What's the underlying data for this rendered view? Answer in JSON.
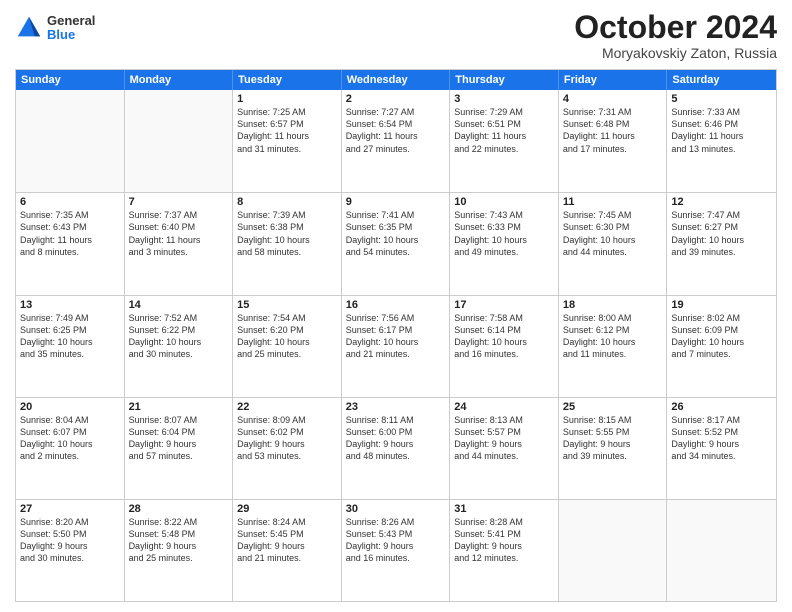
{
  "header": {
    "logo_general": "General",
    "logo_blue": "Blue",
    "month_title": "October 2024",
    "location": "Moryakovskiy Zaton, Russia"
  },
  "calendar": {
    "days": [
      "Sunday",
      "Monday",
      "Tuesday",
      "Wednesday",
      "Thursday",
      "Friday",
      "Saturday"
    ],
    "rows": [
      [
        {
          "num": "",
          "lines": []
        },
        {
          "num": "",
          "lines": []
        },
        {
          "num": "1",
          "lines": [
            "Sunrise: 7:25 AM",
            "Sunset: 6:57 PM",
            "Daylight: 11 hours",
            "and 31 minutes."
          ]
        },
        {
          "num": "2",
          "lines": [
            "Sunrise: 7:27 AM",
            "Sunset: 6:54 PM",
            "Daylight: 11 hours",
            "and 27 minutes."
          ]
        },
        {
          "num": "3",
          "lines": [
            "Sunrise: 7:29 AM",
            "Sunset: 6:51 PM",
            "Daylight: 11 hours",
            "and 22 minutes."
          ]
        },
        {
          "num": "4",
          "lines": [
            "Sunrise: 7:31 AM",
            "Sunset: 6:48 PM",
            "Daylight: 11 hours",
            "and 17 minutes."
          ]
        },
        {
          "num": "5",
          "lines": [
            "Sunrise: 7:33 AM",
            "Sunset: 6:46 PM",
            "Daylight: 11 hours",
            "and 13 minutes."
          ]
        }
      ],
      [
        {
          "num": "6",
          "lines": [
            "Sunrise: 7:35 AM",
            "Sunset: 6:43 PM",
            "Daylight: 11 hours",
            "and 8 minutes."
          ]
        },
        {
          "num": "7",
          "lines": [
            "Sunrise: 7:37 AM",
            "Sunset: 6:40 PM",
            "Daylight: 11 hours",
            "and 3 minutes."
          ]
        },
        {
          "num": "8",
          "lines": [
            "Sunrise: 7:39 AM",
            "Sunset: 6:38 PM",
            "Daylight: 10 hours",
            "and 58 minutes."
          ]
        },
        {
          "num": "9",
          "lines": [
            "Sunrise: 7:41 AM",
            "Sunset: 6:35 PM",
            "Daylight: 10 hours",
            "and 54 minutes."
          ]
        },
        {
          "num": "10",
          "lines": [
            "Sunrise: 7:43 AM",
            "Sunset: 6:33 PM",
            "Daylight: 10 hours",
            "and 49 minutes."
          ]
        },
        {
          "num": "11",
          "lines": [
            "Sunrise: 7:45 AM",
            "Sunset: 6:30 PM",
            "Daylight: 10 hours",
            "and 44 minutes."
          ]
        },
        {
          "num": "12",
          "lines": [
            "Sunrise: 7:47 AM",
            "Sunset: 6:27 PM",
            "Daylight: 10 hours",
            "and 39 minutes."
          ]
        }
      ],
      [
        {
          "num": "13",
          "lines": [
            "Sunrise: 7:49 AM",
            "Sunset: 6:25 PM",
            "Daylight: 10 hours",
            "and 35 minutes."
          ]
        },
        {
          "num": "14",
          "lines": [
            "Sunrise: 7:52 AM",
            "Sunset: 6:22 PM",
            "Daylight: 10 hours",
            "and 30 minutes."
          ]
        },
        {
          "num": "15",
          "lines": [
            "Sunrise: 7:54 AM",
            "Sunset: 6:20 PM",
            "Daylight: 10 hours",
            "and 25 minutes."
          ]
        },
        {
          "num": "16",
          "lines": [
            "Sunrise: 7:56 AM",
            "Sunset: 6:17 PM",
            "Daylight: 10 hours",
            "and 21 minutes."
          ]
        },
        {
          "num": "17",
          "lines": [
            "Sunrise: 7:58 AM",
            "Sunset: 6:14 PM",
            "Daylight: 10 hours",
            "and 16 minutes."
          ]
        },
        {
          "num": "18",
          "lines": [
            "Sunrise: 8:00 AM",
            "Sunset: 6:12 PM",
            "Daylight: 10 hours",
            "and 11 minutes."
          ]
        },
        {
          "num": "19",
          "lines": [
            "Sunrise: 8:02 AM",
            "Sunset: 6:09 PM",
            "Daylight: 10 hours",
            "and 7 minutes."
          ]
        }
      ],
      [
        {
          "num": "20",
          "lines": [
            "Sunrise: 8:04 AM",
            "Sunset: 6:07 PM",
            "Daylight: 10 hours",
            "and 2 minutes."
          ]
        },
        {
          "num": "21",
          "lines": [
            "Sunrise: 8:07 AM",
            "Sunset: 6:04 PM",
            "Daylight: 9 hours",
            "and 57 minutes."
          ]
        },
        {
          "num": "22",
          "lines": [
            "Sunrise: 8:09 AM",
            "Sunset: 6:02 PM",
            "Daylight: 9 hours",
            "and 53 minutes."
          ]
        },
        {
          "num": "23",
          "lines": [
            "Sunrise: 8:11 AM",
            "Sunset: 6:00 PM",
            "Daylight: 9 hours",
            "and 48 minutes."
          ]
        },
        {
          "num": "24",
          "lines": [
            "Sunrise: 8:13 AM",
            "Sunset: 5:57 PM",
            "Daylight: 9 hours",
            "and 44 minutes."
          ]
        },
        {
          "num": "25",
          "lines": [
            "Sunrise: 8:15 AM",
            "Sunset: 5:55 PM",
            "Daylight: 9 hours",
            "and 39 minutes."
          ]
        },
        {
          "num": "26",
          "lines": [
            "Sunrise: 8:17 AM",
            "Sunset: 5:52 PM",
            "Daylight: 9 hours",
            "and 34 minutes."
          ]
        }
      ],
      [
        {
          "num": "27",
          "lines": [
            "Sunrise: 8:20 AM",
            "Sunset: 5:50 PM",
            "Daylight: 9 hours",
            "and 30 minutes."
          ]
        },
        {
          "num": "28",
          "lines": [
            "Sunrise: 8:22 AM",
            "Sunset: 5:48 PM",
            "Daylight: 9 hours",
            "and 25 minutes."
          ]
        },
        {
          "num": "29",
          "lines": [
            "Sunrise: 8:24 AM",
            "Sunset: 5:45 PM",
            "Daylight: 9 hours",
            "and 21 minutes."
          ]
        },
        {
          "num": "30",
          "lines": [
            "Sunrise: 8:26 AM",
            "Sunset: 5:43 PM",
            "Daylight: 9 hours",
            "and 16 minutes."
          ]
        },
        {
          "num": "31",
          "lines": [
            "Sunrise: 8:28 AM",
            "Sunset: 5:41 PM",
            "Daylight: 9 hours",
            "and 12 minutes."
          ]
        },
        {
          "num": "",
          "lines": []
        },
        {
          "num": "",
          "lines": []
        }
      ]
    ]
  }
}
